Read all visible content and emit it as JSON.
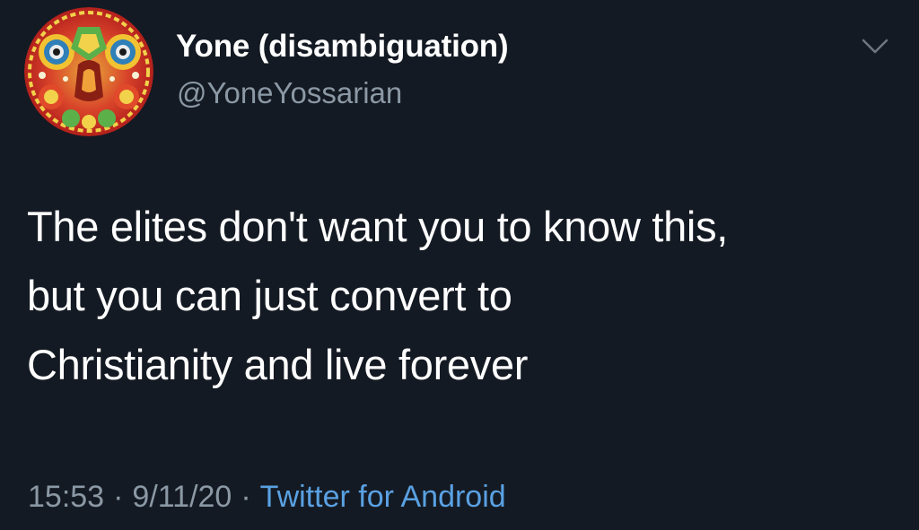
{
  "tweet": {
    "author": {
      "display_name": "Yone (disambiguation)",
      "handle": "@YoneYossarian",
      "avatar_icon": "psychedelic-mandala-avatar"
    },
    "menu_icon": "chevron-down-icon",
    "text": "The elites don't want you to know this,\nbut you can just convert to\nChristianity and live forever",
    "time": "15:53",
    "date": "9/11/20",
    "separator": "·",
    "source": "Twitter for Android"
  },
  "colors": {
    "background": "#141a23",
    "text": "#ffffff",
    "secondary_text": "#8b98a5",
    "link": "#5aa1e3"
  }
}
